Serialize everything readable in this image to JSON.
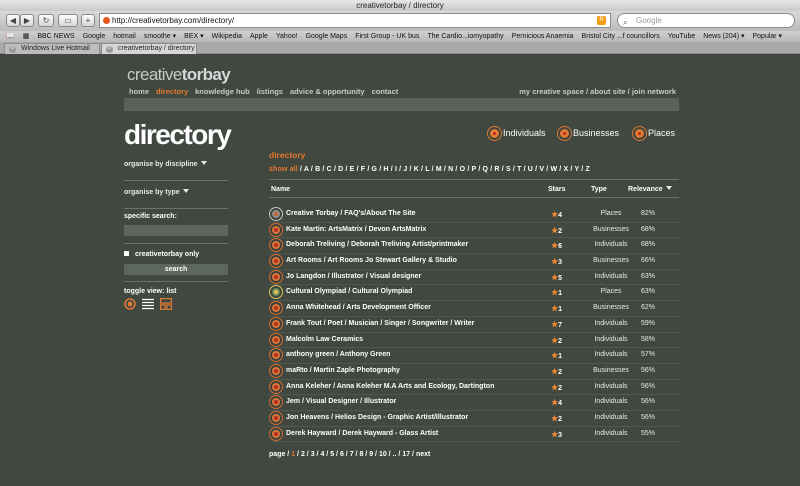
{
  "browser": {
    "window_title": "creativetorbay / directory",
    "url": "http://creativetorbay.com/directory/",
    "search_placeholder": "Google",
    "bookmarks": [
      "BBC NEWS",
      "Google",
      "hotmail",
      "smoothe ▾",
      "BEX ▾",
      "Wikipedia",
      "Apple",
      "Yahoo!",
      "Google Maps",
      "First Group - UK bus",
      "The Cardio...iomyopathy",
      "Pernicious Anaemia",
      "Bristol City ...f councillors",
      "YouTube",
      "News (204) ▾",
      "Popular ▾"
    ],
    "tabs": [
      {
        "label": "Windows Live Hotmail",
        "active": false
      },
      {
        "label": "creativetorbay / directory",
        "active": true
      }
    ]
  },
  "site": {
    "logo_a": "creative",
    "logo_b": "torbay",
    "nav": [
      {
        "label": "home",
        "current": false
      },
      {
        "label": "directory",
        "current": true
      },
      {
        "label": "knowledge hub",
        "current": false
      },
      {
        "label": "listings",
        "current": false
      },
      {
        "label": "advice & opportunity",
        "current": false
      },
      {
        "label": "contact",
        "current": false
      }
    ],
    "nav_right": "my creative space  /  about site / join network"
  },
  "page": {
    "title": "directory",
    "heading": "directory",
    "filters": [
      "Individuals",
      "Businesses",
      "Places"
    ]
  },
  "sidebar": {
    "organise_discipline": "organise by discipline",
    "organise_type": "organise by type",
    "specific_search": "specific search:",
    "only_label": "creativetorbay only",
    "search_button": "search",
    "toggle_view": "toggle view: list"
  },
  "alphabet": {
    "show_all": "show all",
    "letters": [
      "A",
      "B",
      "C",
      "D",
      "E",
      "F",
      "G",
      "H",
      "I",
      "J",
      "K",
      "L",
      "M",
      "N",
      "O",
      "P",
      "Q",
      "R",
      "S",
      "T",
      "U",
      "V",
      "W",
      "X",
      "Y",
      "Z"
    ]
  },
  "table": {
    "headers": {
      "name": "Name",
      "stars": "Stars",
      "type": "Type",
      "relevance": "Relevance"
    },
    "rows": [
      {
        "name": "Creative Torbay / FAQ's/About The Site",
        "stars": "4",
        "type": "Places",
        "relevance": "82%",
        "icon": "place"
      },
      {
        "name": "Kate Martin: ArtsMatrix / Devon ArtsMatrix",
        "stars": "2",
        "type": "Businesses",
        "relevance": "68%",
        "icon": "std"
      },
      {
        "name": "Deborah Treliving / Deborah Treliving Artist/printmaker",
        "stars": "6",
        "type": "Individuals",
        "relevance": "68%",
        "icon": "std"
      },
      {
        "name": "Art Rooms / Art Rooms Jo Stewart Gallery & Studio",
        "stars": "3",
        "type": "Businesses",
        "relevance": "66%",
        "icon": "std"
      },
      {
        "name": "Jo Langdon / Illustrator / Visual designer",
        "stars": "5",
        "type": "Individuals",
        "relevance": "63%",
        "icon": "std"
      },
      {
        "name": "Cultural Olympiad / Cultural Olympiad",
        "stars": "1",
        "type": "Places",
        "relevance": "63%",
        "icon": "olymp"
      },
      {
        "name": "Anna Whitehead / Arts Development Officer",
        "stars": "1",
        "type": "Businesses",
        "relevance": "62%",
        "icon": "std"
      },
      {
        "name": "Frank Tout / Poet / Musician / Singer / Songwriter / Writer",
        "stars": "7",
        "type": "Individuals",
        "relevance": "59%",
        "icon": "std"
      },
      {
        "name": "Malcolm Law Ceramics",
        "stars": "2",
        "type": "Individuals",
        "relevance": "58%",
        "icon": "std"
      },
      {
        "name": "anthony green / Anthony Green",
        "stars": "1",
        "type": "Individuals",
        "relevance": "57%",
        "icon": "std"
      },
      {
        "name": "maRto / Martin Zaple Photography",
        "stars": "2",
        "type": "Businesses",
        "relevance": "56%",
        "icon": "std"
      },
      {
        "name": "Anna Keleher / Anna Keleher M.A Arts and Ecology, Dartington",
        "stars": "2",
        "type": "Individuals",
        "relevance": "56%",
        "icon": "std"
      },
      {
        "name": "Jem / Visual Designer / Illustrator",
        "stars": "4",
        "type": "Individuals",
        "relevance": "56%",
        "icon": "std"
      },
      {
        "name": "Jon Heavens / Helios Design - Graphic Artist/Illustrator",
        "stars": "2",
        "type": "Individuals",
        "relevance": "56%",
        "icon": "std"
      },
      {
        "name": "Derek Hayward / Derek Hayward - Glass Artist",
        "stars": "3",
        "type": "Individuals",
        "relevance": "55%",
        "icon": "std"
      }
    ]
  },
  "pager": {
    "label": "page",
    "current": "1",
    "pages": [
      "2",
      "3",
      "4",
      "5",
      "6",
      "7",
      "8",
      "9",
      "10",
      "..",
      "17"
    ],
    "next": "next"
  }
}
